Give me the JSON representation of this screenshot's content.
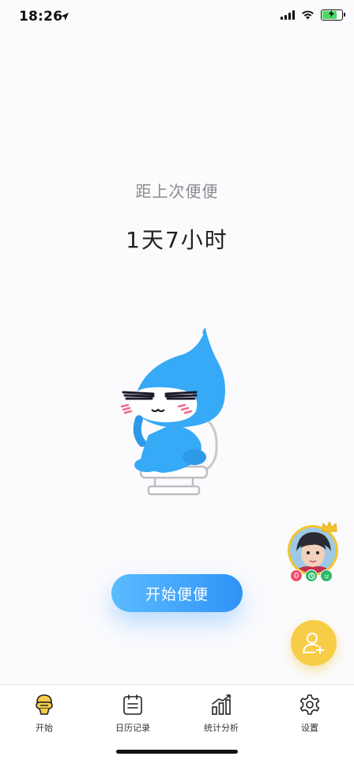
{
  "status_bar": {
    "time": "18:26"
  },
  "main": {
    "subtitle": "距上次便便",
    "duration": "1天7小时",
    "start_button_label": "开始便便"
  },
  "floating": {
    "badge_count": "0"
  },
  "tab_bar": {
    "tabs": [
      {
        "label": "开始",
        "icon": "toilet-icon"
      },
      {
        "label": "日历记录",
        "icon": "calendar-icon"
      },
      {
        "label": "统计分析",
        "icon": "chart-icon"
      },
      {
        "label": "设置",
        "icon": "gear-icon"
      }
    ]
  },
  "colors": {
    "accent": "#3aa3fa",
    "mascot": "#36a9f7",
    "gold": "#f7cd47"
  }
}
